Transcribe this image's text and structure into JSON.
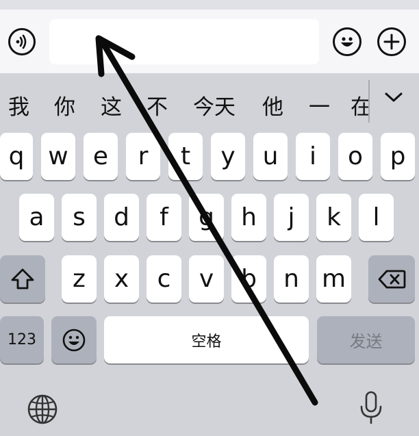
{
  "input_bar": {
    "field_value": "",
    "field_placeholder": "",
    "left_icon": "voice-wave-icon",
    "emoji_icon": "smiley-icon",
    "plus_icon": "plus-icon"
  },
  "candidates": {
    "items": [
      "我",
      "你",
      "这",
      "不",
      "今天",
      "他",
      "一",
      "在"
    ],
    "expand_icon": "chevron-down-icon"
  },
  "keyboard": {
    "row1": [
      "q",
      "w",
      "e",
      "r",
      "t",
      "y",
      "u",
      "i",
      "o",
      "p"
    ],
    "row2": [
      "a",
      "s",
      "d",
      "f",
      "g",
      "h",
      "j",
      "k",
      "l"
    ],
    "row3": [
      "z",
      "x",
      "c",
      "v",
      "b",
      "n",
      "m"
    ],
    "shift_icon": "shift-arrow-icon",
    "delete_icon": "backspace-icon",
    "numbers_label": "123",
    "emoji_key_icon": "smiley-icon",
    "space_label": "空格",
    "send_label": "发送"
  },
  "bottom_bar": {
    "globe_icon": "globe-icon",
    "mic_icon": "microphone-icon"
  },
  "overlay": {
    "arrow_icon": "arrow-up-left-icon",
    "arrow_color": "#0b0b0b"
  }
}
